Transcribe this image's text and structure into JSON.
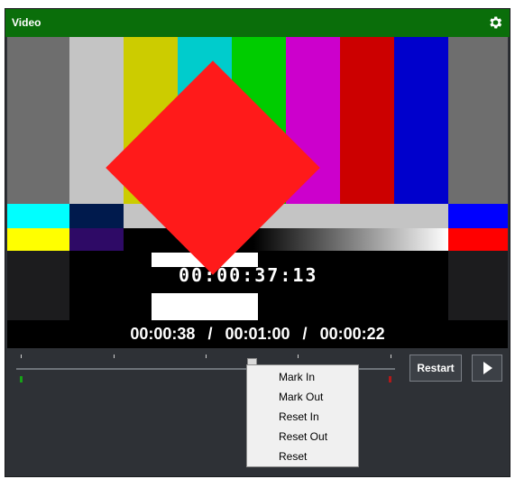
{
  "panel": {
    "title": "Video",
    "settings_icon": "gear-icon"
  },
  "timecode": {
    "overlay": "00:00:37:13",
    "current": "00:00:38",
    "duration": "00:01:00",
    "remaining": "00:00:22",
    "separator": "/"
  },
  "controls": {
    "restart_label": "Restart",
    "play_icon": "play-icon"
  },
  "context_menu": {
    "items": [
      "Mark In",
      "Mark Out",
      "Reset In",
      "Reset Out",
      "Reset"
    ]
  },
  "colors": {
    "title_bar": "#0a6e0a",
    "panel_bg": "#2e3136",
    "mark_in": "#17a217",
    "mark_out": "#b21a1a"
  }
}
